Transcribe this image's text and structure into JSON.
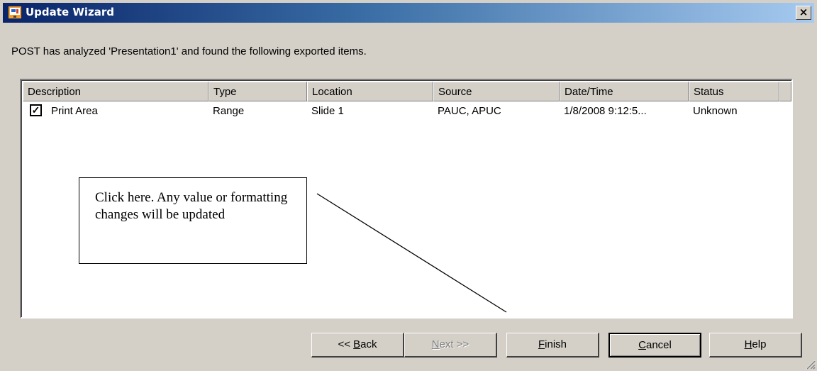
{
  "window": {
    "title": "Update Wizard",
    "close_label": "×"
  },
  "message": "POST has analyzed 'Presentation1' and found the following exported items.",
  "columns": [
    "Description",
    "Type",
    "Location",
    "Source",
    "Date/Time",
    "Status"
  ],
  "rows": [
    {
      "checked": true,
      "description": "Print Area",
      "type": "Range",
      "location": "Slide 1",
      "source": "PAUC, APUC",
      "datetime": "1/8/2008 9:12:5...",
      "status": "Unknown"
    }
  ],
  "callout": {
    "text": "Click here.  Any value or formatting changes will be updated"
  },
  "buttons": {
    "back": {
      "prefix": "<< ",
      "underlined": "B",
      "rest": "ack"
    },
    "next": {
      "underlined": "N",
      "rest": "ext >>"
    },
    "finish": {
      "underlined": "F",
      "rest": "inish"
    },
    "cancel": {
      "underlined": "C",
      "rest": "ancel"
    },
    "help": {
      "underlined": "H",
      "rest": "elp"
    }
  },
  "colors": {
    "titlebar_start": "#0a246a",
    "titlebar_end": "#a6caf0",
    "face": "#d4d0c8"
  }
}
